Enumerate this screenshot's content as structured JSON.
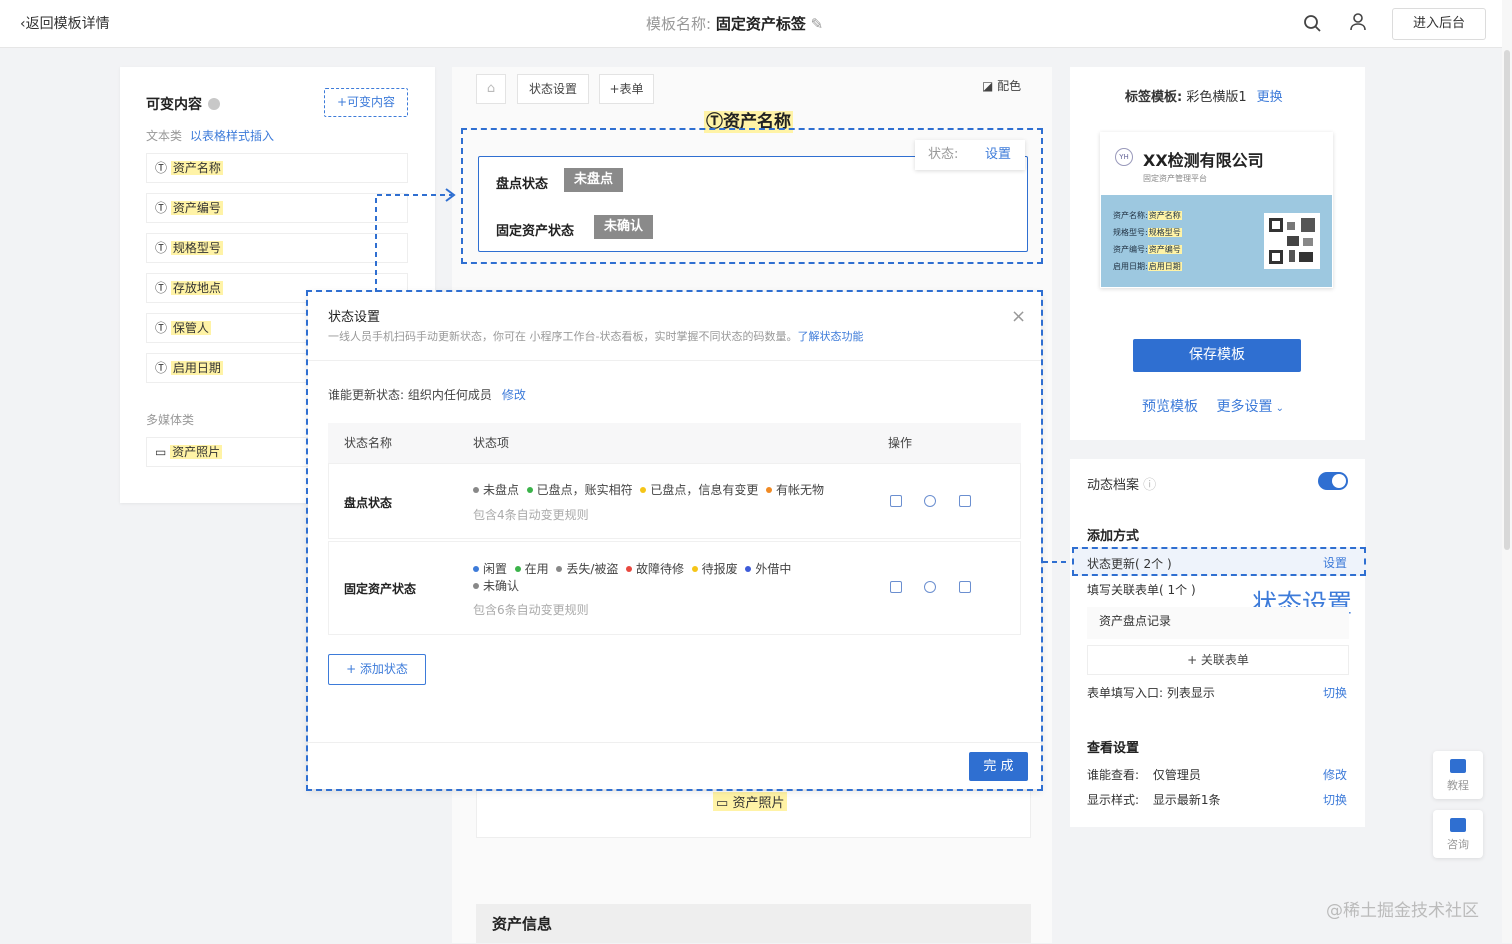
{
  "topbar": {
    "back": "返回模板详情",
    "title_label": "模板名称:",
    "title_value": "固定资产标签",
    "enter_backend": "进入后台"
  },
  "variables": {
    "title": "可变内容",
    "add_button": "+可变内容",
    "text_category": "文本类",
    "insert_table_link": "以表格样式插入",
    "fields": [
      "资产名称",
      "资产编号",
      "规格型号",
      "存放地点",
      "保管人",
      "启用日期"
    ],
    "media_category": "多媒体类",
    "media_fields": [
      "资产照片"
    ]
  },
  "canvas": {
    "toolbar": {
      "state_settings": "状态设置",
      "add_form": "+表单",
      "color": "配色"
    },
    "asset_name_field": "资产名称",
    "status_rows": [
      {
        "label": "盘点状态",
        "tag": "未盘点"
      },
      {
        "label": "固定资产状态",
        "tag": "未确认"
      }
    ],
    "state_popup": {
      "label": "状态:",
      "action": "设置"
    },
    "photo_field": "资产照片",
    "asset_info": "资产信息"
  },
  "modal": {
    "title": "状态设置",
    "desc": "一线人员手机扫码手动更新状态，你可在 小程序工作台-状态看板，实时掌握不同状态的码数量。",
    "desc_link": "了解状态功能",
    "who_label": "谁能更新状态:",
    "who_value": "组织内任何成员",
    "who_edit": "修改",
    "columns": [
      "状态名称",
      "状态项",
      "操作"
    ],
    "rows": [
      {
        "name": "盘点状态",
        "items": [
          {
            "label": "未盘点",
            "color": "#888888"
          },
          {
            "label": "已盘点，账实相符",
            "color": "#3bb34a"
          },
          {
            "label": "已盘点，信息有变更",
            "color": "#f5c518"
          },
          {
            "label": "有帐无物",
            "color": "#f08a24"
          }
        ],
        "rule": "包含4条自动变更规则"
      },
      {
        "name": "固定资产状态",
        "items": [
          {
            "label": "闲置",
            "color": "#3d7bd9"
          },
          {
            "label": "在用",
            "color": "#3bb34a"
          },
          {
            "label": "丢失/被盗",
            "color": "#888888"
          },
          {
            "label": "故障待修",
            "color": "#e8483f"
          },
          {
            "label": "待报废",
            "color": "#f5c518"
          },
          {
            "label": "外借中",
            "color": "#3d5bd9"
          },
          {
            "label": "未确认",
            "color": "#888888"
          }
        ],
        "rule": "包含6条自动变更规则"
      }
    ],
    "add_state": "+ 添加状态",
    "done": "完 成"
  },
  "right": {
    "label_template_label": "标签模板:",
    "label_template_value": "彩色横版1",
    "replace": "更换",
    "preview": {
      "logo": "YH",
      "company": "XX检测有限公司",
      "company_sub": "固定资产管理平台",
      "rows": [
        {
          "k": "资产名称:",
          "v": "资产名称"
        },
        {
          "k": "规格型号:",
          "v": "规格型号"
        },
        {
          "k": "资产编号:",
          "v": "资产编号"
        },
        {
          "k": "启用日期:",
          "v": "启用日期"
        }
      ]
    },
    "save": "保存模板",
    "preview_link": "预览模板",
    "more_settings": "更多设置"
  },
  "dynamic": {
    "title": "动态档案",
    "add_method": "添加方式",
    "state_update": "状态更新( 2个 )",
    "state_update_action": "设置",
    "fill_form": "填写关联表单( 1个 )",
    "annotation": "状态设置",
    "form_item": "资产盘点记录",
    "link_form": "+ 关联表单",
    "entry_label": "表单填写入口:",
    "entry_value": "列表显示",
    "entry_action": "切换",
    "view_settings": "查看设置",
    "who_view_label": "谁能查看:",
    "who_view_value": "仅管理员",
    "who_view_action": "修改",
    "display_label": "显示样式:",
    "display_value": "显示最新1条",
    "display_action": "切换"
  },
  "float": {
    "tutorial": "教程",
    "consult": "咨询"
  },
  "watermark": "@稀土掘金技术社区"
}
